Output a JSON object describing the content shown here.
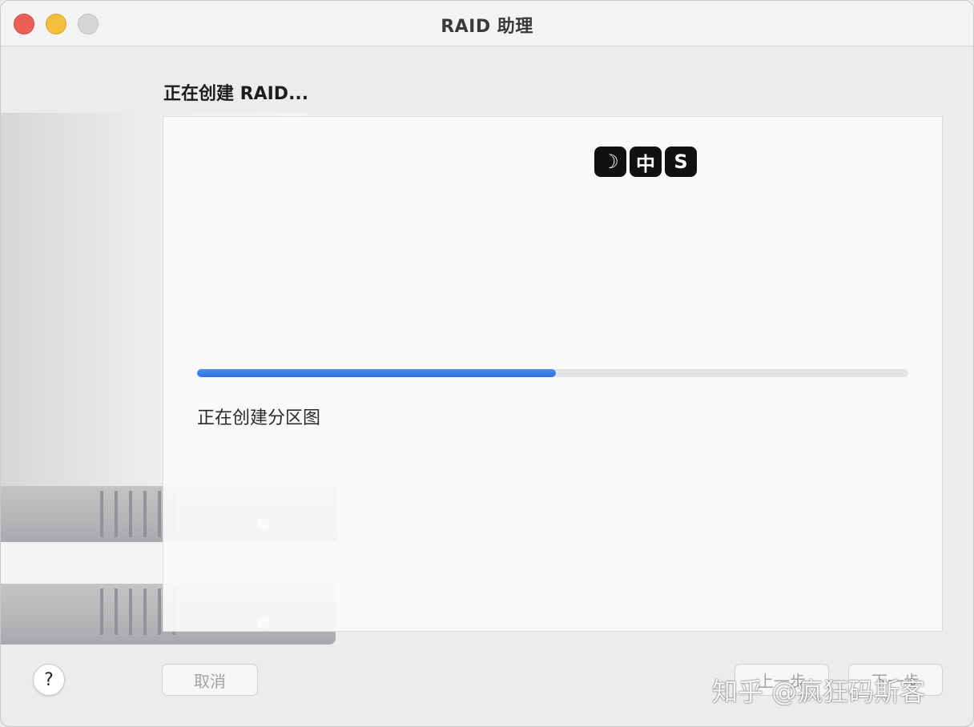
{
  "window": {
    "title": "RAID 助理"
  },
  "step": {
    "heading": "正在创建 RAID..."
  },
  "logo": {
    "tiles": [
      "☽",
      "中",
      "S"
    ]
  },
  "progress": {
    "fraction": 0.505,
    "status_text": "正在创建分区图"
  },
  "buttons": {
    "help_label": "?",
    "cancel_label": "取消",
    "previous_label": "上一步",
    "next_label": "下一步"
  },
  "watermark": {
    "text": "知乎 @疯狂码斯客"
  },
  "colors": {
    "progress_accent": "#2d6fe0",
    "close": "#ec5f57",
    "minimize": "#f4bf3d",
    "zoom": "#d6d6d6"
  }
}
